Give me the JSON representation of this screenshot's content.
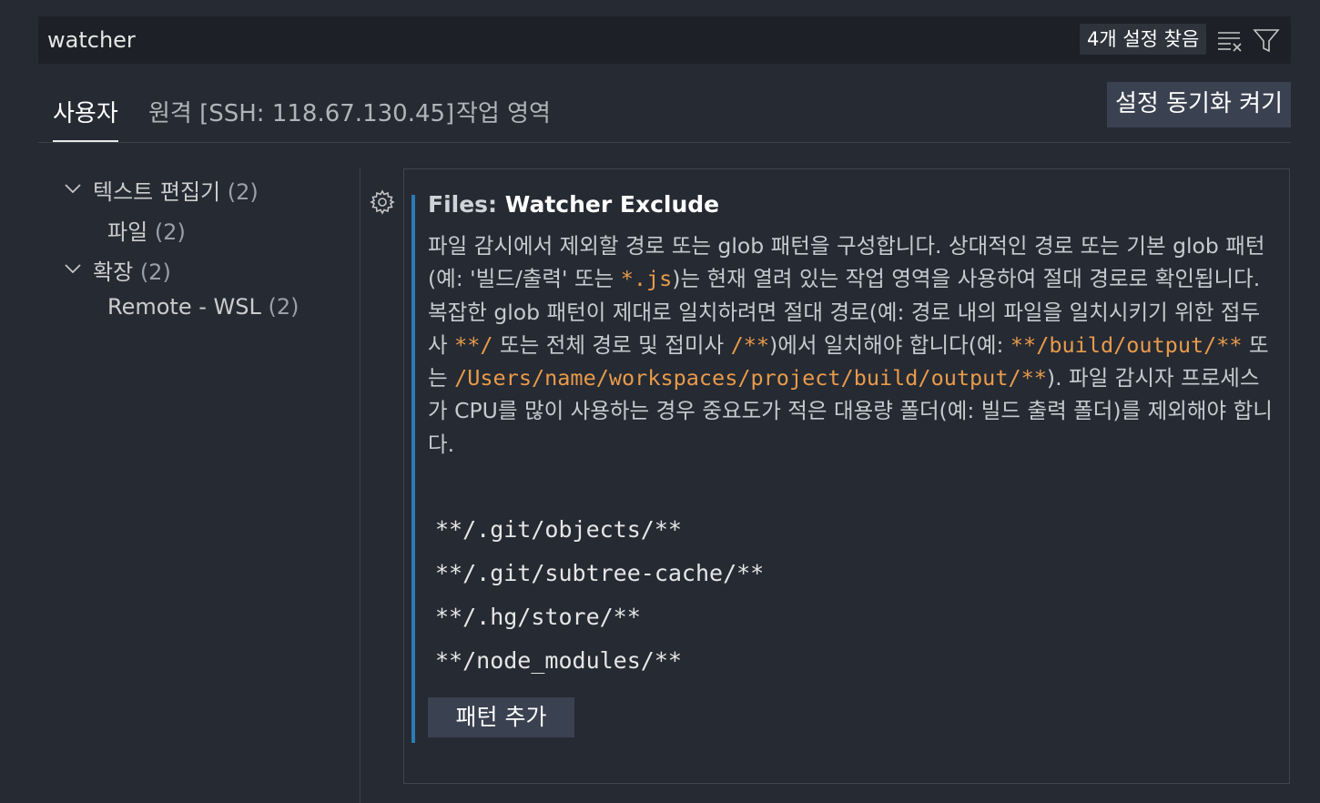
{
  "search": {
    "value": "watcher",
    "result_count": "4개 설정 찾음"
  },
  "tabs": [
    {
      "label": "사용자"
    },
    {
      "label": "원격 [SSH: 118.67.130.45]"
    },
    {
      "label": "작업 영역"
    }
  ],
  "sync_button": "설정 동기화 켜기",
  "toc": [
    {
      "label": "텍스트 편집기",
      "count": "(2)"
    },
    {
      "label": "파일",
      "count": "(2)"
    },
    {
      "label": "확장",
      "count": "(2)"
    },
    {
      "label": "Remote - WSL",
      "count": "(2)"
    }
  ],
  "setting": {
    "category": "Files: ",
    "name": "Watcher Exclude",
    "description": {
      "p1": "파일 감시에서 제외할 경로 또는 glob 패턴을 구성합니다. 상대적인 경로 또는 기본 glob 패턴(예: '빌드/출력' 또는 ",
      "c1": "*.js",
      "p2": ")는 현재 열려 있는 작업 영역을 사용하여 절대 경로로 확인됩니다. 복잡한 glob 패턴이 제대로 일치하려면 절대 경로(예: 경로 내의 파일을 일치시키기 위한 접두사 ",
      "c2": "**/",
      "p3": " 또는 전체 경로 및 접미사 ",
      "c3": "/**",
      "p4": ")에서 일치해야 합니다(예: ",
      "c4": "**/build/output/**",
      "p5": " 또는 ",
      "c5": "/Users/name/workspaces/project/build/output/**",
      "p6": "). 파일 감시자 프로세스가 CPU를 많이 사용하는 경우 중요도가 적은 대용량 폴더(예: 빌드 출력 폴더)를 제외해야 합니다."
    },
    "patterns": [
      "**/.git/objects/**",
      "**/.git/subtree-cache/**",
      "**/.hg/store/**",
      "**/node_modules/**"
    ],
    "add_button": "패턴 추가"
  }
}
